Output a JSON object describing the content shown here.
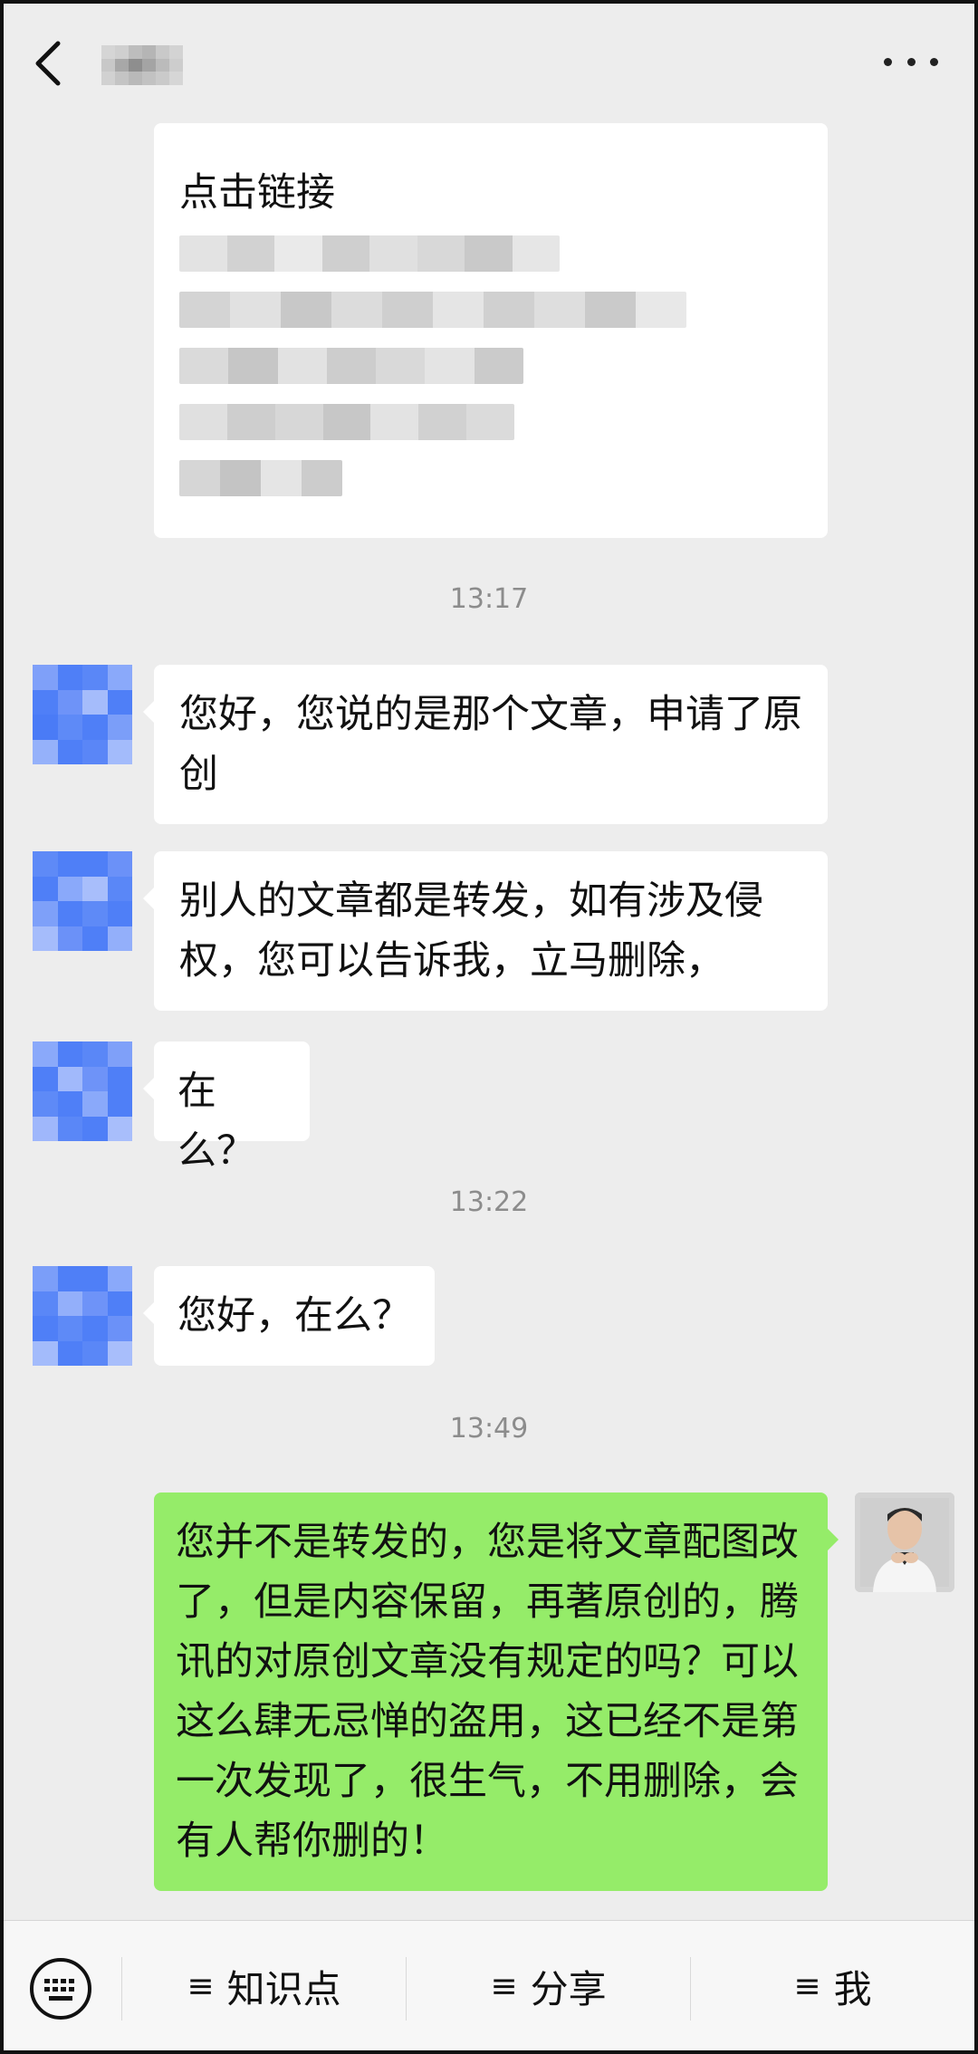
{
  "header": {
    "contact_name": "",
    "back_icon": "chevron-left-icon",
    "more_icon": "more-dots-icon"
  },
  "messages": [
    {
      "sender": "contact",
      "text": "点击链接"
    },
    {
      "type": "timestamp",
      "text": "13:17"
    },
    {
      "sender": "contact",
      "text": "您好，您说的是那个文章，申请了原创"
    },
    {
      "sender": "contact",
      "text": "别人的文章都是转发，如有涉及侵权，您可以告诉我，立马删除，"
    },
    {
      "sender": "contact",
      "text": "在么？"
    },
    {
      "type": "timestamp",
      "text": "13:22"
    },
    {
      "sender": "contact",
      "text": "您好，在么？"
    },
    {
      "type": "timestamp",
      "text": "13:49"
    },
    {
      "sender": "self",
      "text": "您并不是转发的，您是将文章配图改了，但是内容保留，再著原创的，腾讯的对原创文章没有规定的吗？可以这么肆无忌惮的盗用，这已经不是第一次发现了，很生气，不用删除，会有人帮你删的！"
    }
  ],
  "bottom_menu": {
    "keyboard_icon": "keyboard-icon",
    "items": [
      {
        "label": "知识点",
        "icon": "menu-lines-icon"
      },
      {
        "label": "分享",
        "icon": "menu-lines-icon"
      },
      {
        "label": "我",
        "icon": "menu-lines-icon"
      }
    ]
  },
  "colors": {
    "background": "#ededed",
    "bubble_left": "#ffffff",
    "bubble_right": "#95ec69",
    "avatar_blue": "#4f7ff7"
  }
}
